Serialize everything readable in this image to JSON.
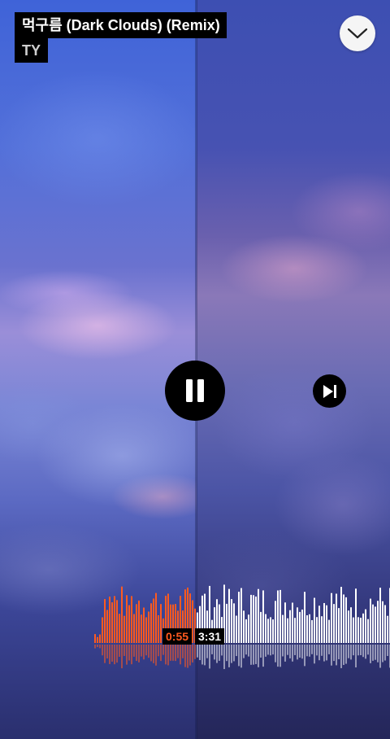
{
  "track": {
    "title": "먹구름 (Dark Clouds) (Remix)",
    "artist": "TY"
  },
  "player": {
    "elapsed": "0:55",
    "duration": "3:31",
    "state": "playing",
    "progress_fraction": 0.26
  },
  "icons": {
    "collapse": "chevron-down-icon",
    "pause": "pause-icon",
    "next": "skip-next-icon"
  },
  "colors": {
    "played": "#ff5a1f",
    "unplayed": "#ffffff",
    "button_bg": "#000000"
  }
}
